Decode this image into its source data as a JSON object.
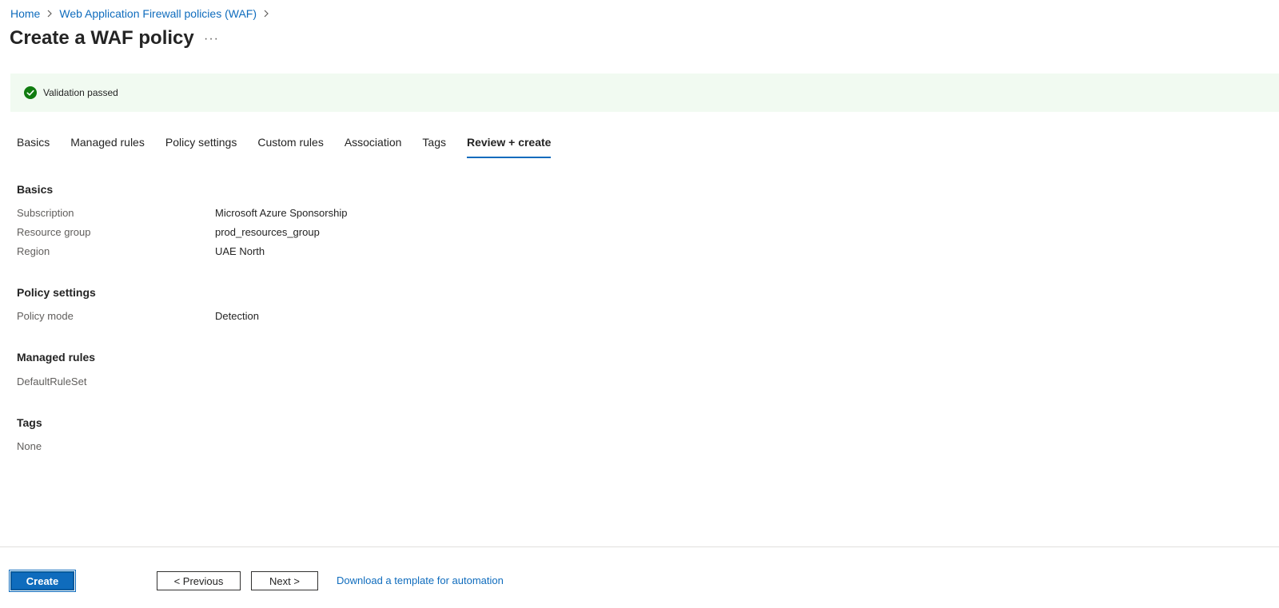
{
  "breadcrumb": {
    "home": "Home",
    "waf": "Web Application Firewall policies (WAF)"
  },
  "page": {
    "title": "Create a WAF policy",
    "more": "···"
  },
  "banner": {
    "text": "Validation passed",
    "color": "#107c10"
  },
  "tabs": [
    {
      "label": "Basics"
    },
    {
      "label": "Managed rules"
    },
    {
      "label": "Policy settings"
    },
    {
      "label": "Custom rules"
    },
    {
      "label": "Association"
    },
    {
      "label": "Tags"
    },
    {
      "label": "Review + create",
      "active": true
    }
  ],
  "review": {
    "basics": {
      "title": "Basics",
      "rows": [
        {
          "label": "Subscription",
          "value": "Microsoft Azure Sponsorship"
        },
        {
          "label": "Resource group",
          "value": "prod_resources_group"
        },
        {
          "label": "Region",
          "value": "UAE North"
        }
      ]
    },
    "policy_settings": {
      "title": "Policy settings",
      "rows": [
        {
          "label": "Policy mode",
          "value": "Detection"
        }
      ]
    },
    "managed_rules": {
      "title": "Managed rules",
      "item": "DefaultRuleSet"
    },
    "tags": {
      "title": "Tags",
      "item": "None"
    }
  },
  "footer": {
    "create": "Create",
    "previous": "< Previous",
    "next": "Next >",
    "template_link": "Download a template for automation"
  },
  "colors": {
    "accent": "#0f6cbd",
    "success_bg": "#f1faf1"
  }
}
